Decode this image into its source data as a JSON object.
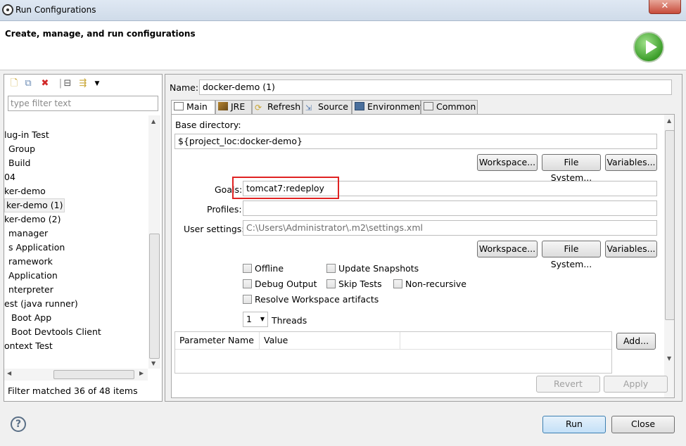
{
  "window": {
    "title": "Run Configurations",
    "close_glyph": "✕"
  },
  "banner": {
    "heading": "Create, manage, and run configurations"
  },
  "left": {
    "filter_placeholder": "type filter text",
    "tree_items": [
      "lug-in Test",
      "Group",
      "Build",
      "04",
      "ker-demo",
      "ker-demo (1)",
      "ker-demo (2)",
      "manager",
      "s Application",
      "ramework",
      "Application",
      "nterpreter",
      "est (java runner)",
      "Boot App",
      "Boot Devtools Client",
      "ontext Test"
    ],
    "selected_index": 5,
    "status": "Filter matched 36 of 48 items"
  },
  "main": {
    "name_label": "Name:",
    "name_value": "docker-demo (1)",
    "tabs": [
      "Main",
      "JRE",
      "Refresh",
      "Source",
      "Environment",
      "Common"
    ],
    "active_tab": "Main",
    "base_dir_label": "Base directory:",
    "base_dir_value": "${project_loc:docker-demo}",
    "buttons": {
      "workspace": "Workspace...",
      "filesystem": "File System...",
      "variables": "Variables..."
    },
    "goals_label": "Goals:",
    "goals_value": "tomcat7:redeploy",
    "profiles_label": "Profiles:",
    "profiles_value": "",
    "user_settings_label": "User settings:",
    "user_settings_value": "C:\\Users\\Administrator\\.m2\\settings.xml",
    "checkboxes": {
      "offline": "Offline",
      "update_snapshots": "Update Snapshots",
      "debug_output": "Debug Output",
      "skip_tests": "Skip Tests",
      "non_recursive": "Non-recursive",
      "resolve_workspace": "Resolve Workspace artifacts"
    },
    "threads_value": "1",
    "threads_label": "Threads",
    "table_headers": [
      "Parameter Name",
      "Value"
    ],
    "add_button": "Add...",
    "revert_button": "Revert",
    "apply_button": "Apply"
  },
  "footer": {
    "help_glyph": "?",
    "run_button": "Run",
    "close_button": "Close"
  },
  "colors": {
    "highlight_box": "#e02222",
    "run_badge": "#3c9e2a"
  }
}
